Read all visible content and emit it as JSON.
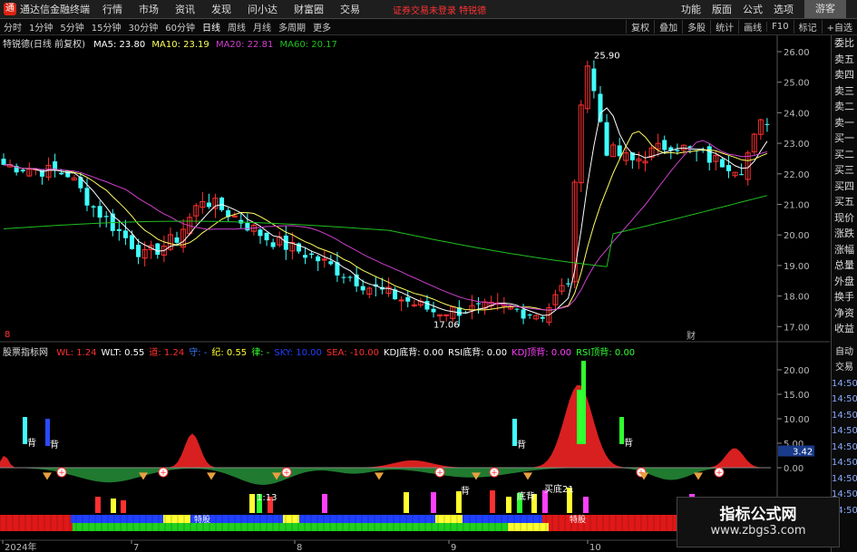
{
  "app": {
    "title": "通达信金融终端",
    "menu": [
      "行情",
      "市场",
      "资讯",
      "发现",
      "问小达",
      "财富圈",
      "交易"
    ],
    "notice": "证券交易未登录  特锐德",
    "right_menu": [
      "功能",
      "版面",
      "公式",
      "选项"
    ],
    "guest": "游客"
  },
  "periods": [
    "分时",
    "1分钟",
    "5分钟",
    "15分钟",
    "30分钟",
    "60分钟",
    "日线",
    "周线",
    "月线",
    "多周期",
    "更多"
  ],
  "active_period": "日线",
  "toolbar_right": [
    "复权",
    "叠加",
    "多股",
    "统计",
    "画线",
    "F10",
    "标记",
    "+自选"
  ],
  "main_legend": {
    "stock": "特锐德(日线 前复权)",
    "ma5": "MA5: 23.80",
    "ma10": "MA10: 23.19",
    "ma20": "MA20: 22.81",
    "ma60": "MA60: 20.17"
  },
  "sub_legend": {
    "name": "股票指标网",
    "items": [
      {
        "text": "WL: 1.24",
        "color": "#ff3030"
      },
      {
        "text": "WLT: 0.55",
        "color": "#ffffff"
      },
      {
        "text": "道: 1.24",
        "color": "#ff3030"
      },
      {
        "text": "守: -",
        "color": "#3b7bff"
      },
      {
        "text": "纪: 0.55",
        "color": "#ffff30"
      },
      {
        "text": "律: -",
        "color": "#30ff30"
      },
      {
        "text": "SKY: 10.00",
        "color": "#2040ff"
      },
      {
        "text": "SEA: -10.00",
        "color": "#ff3030"
      },
      {
        "text": "KDJ底背: 0.00",
        "color": "#ffffff"
      },
      {
        "text": "RSI底背: 0.00",
        "color": "#ffffff"
      },
      {
        "text": "KDJ顶背: 0.00",
        "color": "#ff40ff"
      },
      {
        "text": "RSI顶背: 0.00",
        "color": "#30ff30"
      }
    ]
  },
  "price_axis": [
    "26.00",
    "25.00",
    "24.00",
    "23.00",
    "22.00",
    "21.00",
    "20.00",
    "19.00",
    "18.00",
    "17.00"
  ],
  "sub_axis": [
    "20.00",
    "15.00",
    "10.00",
    "5.00",
    "0.00"
  ],
  "sub_axis_value": "3.42",
  "right_panel": [
    "委比",
    "卖五",
    "卖四",
    "卖三",
    "卖二",
    "卖一",
    "买一",
    "买二",
    "买三",
    "买四",
    "买五",
    "现价",
    "涨跌",
    "涨幅",
    "总量",
    "外盘",
    "换手",
    "净资",
    "收益"
  ],
  "right_panel_lower": [
    "自动",
    "交易",
    "14:50",
    "14:50",
    "14:50",
    "14:50",
    "14:50",
    "14:50",
    "14:50",
    "14:50",
    "14:50"
  ],
  "date_axis": [
    "2024年",
    "7",
    "8",
    "9",
    "10"
  ],
  "annotations": {
    "high": "25.90",
    "low": "17.06",
    "cai": "财",
    "eight": "8"
  },
  "signal_labels": [
    "背",
    "背",
    "背",
    "背",
    "背",
    "买底21",
    "特股",
    "特股",
    "底背",
    "1:13"
  ],
  "watermark": {
    "title": "指标公式网",
    "url": "www.zbgs3.com"
  },
  "colors": {
    "up": "#ff3030",
    "down": "#40ffff",
    "ma5": "#ffffff",
    "ma10": "#ffff60",
    "ma20": "#d040d0",
    "ma60": "#20c020"
  }
}
